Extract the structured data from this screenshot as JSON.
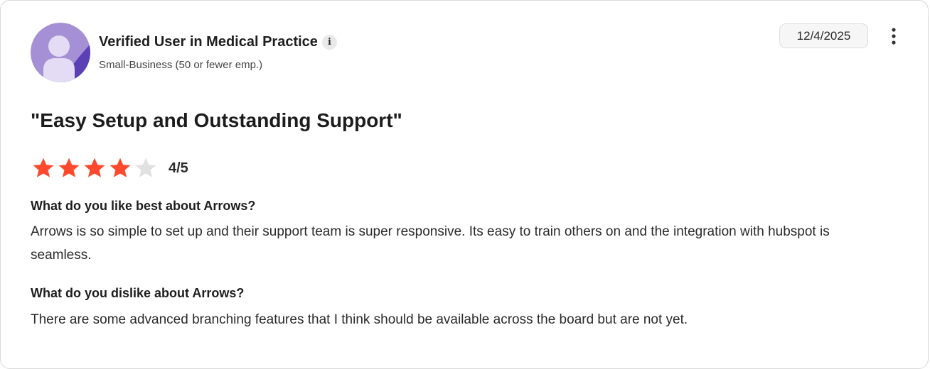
{
  "reviewer": {
    "name": "Verified User in Medical Practice",
    "info_icon_glyph": "i",
    "segment": "Small-Business (50 or fewer emp.)",
    "avatar_icon": "user-avatar-icon",
    "avatar_colors": {
      "background": "#a590d6",
      "shadow": "#5b3fb5",
      "figure": "#e3dcf4"
    }
  },
  "review": {
    "date": "12/4/2025",
    "menu_icon": "more-vertical-icon",
    "title": "\"Easy Setup and Outstanding Support\"",
    "rating": {
      "value": 4,
      "max": 5,
      "text": "4/5",
      "filled_color": "#ff492c",
      "empty_color": "#e1e1e1"
    },
    "questions": [
      {
        "question": "What do you like best about Arrows?",
        "answer": "Arrows is so simple to set up and their support team is super responsive. Its easy to train others on and the integration with hubspot is seamless."
      },
      {
        "question": "What do you dislike about Arrows?",
        "answer": "There are some advanced branching features that I think should be available across the board but are not yet."
      }
    ]
  }
}
